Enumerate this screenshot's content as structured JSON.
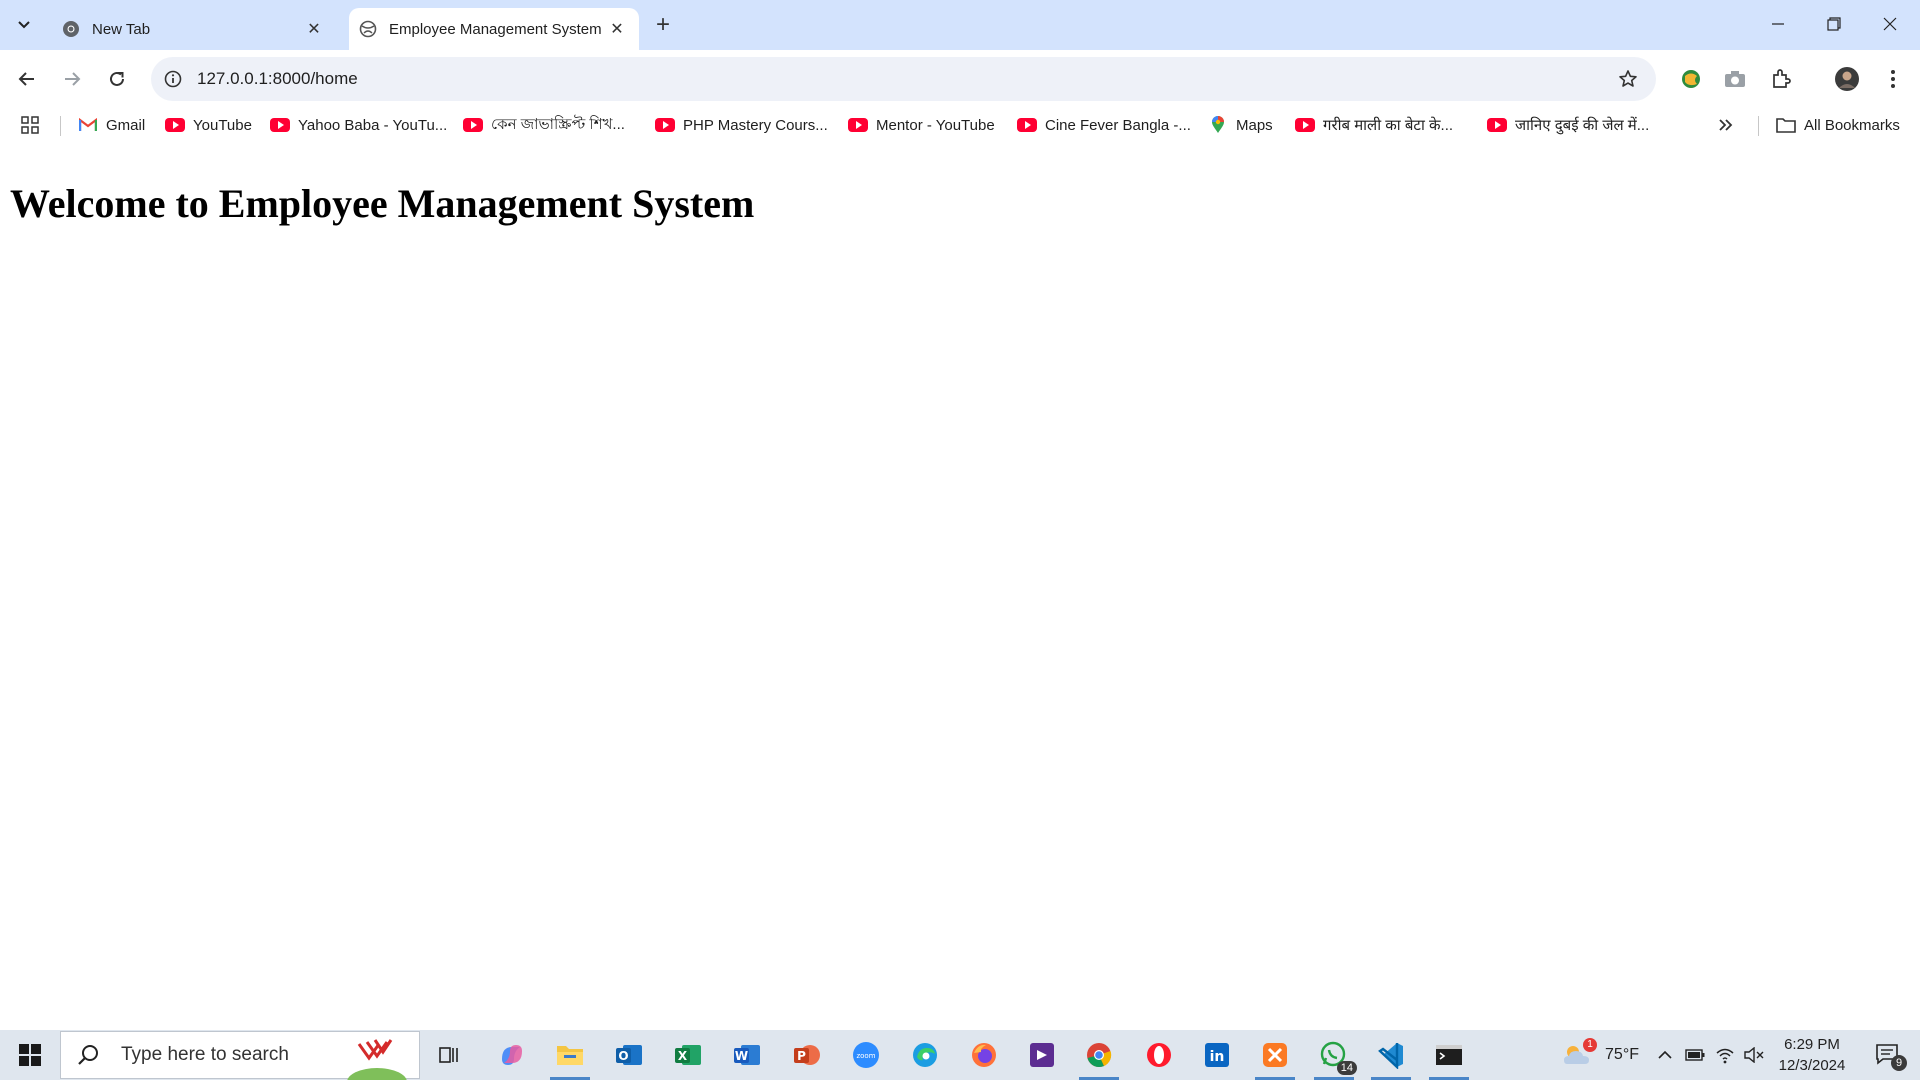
{
  "browser": {
    "tabs": [
      {
        "title": "New Tab",
        "active": false
      },
      {
        "title": "Employee Management System",
        "active": true
      }
    ],
    "address": {
      "url": "127.0.0.1:8000/home"
    },
    "bookmarks": [
      {
        "label": "Gmail",
        "icon": "gmail-icon"
      },
      {
        "label": "YouTube",
        "icon": "youtube-icon"
      },
      {
        "label": "Yahoo Baba - YouTu...",
        "icon": "youtube-icon"
      },
      {
        "label": "কেন জাভাস্ক্রিপ্ট শিখ...",
        "icon": "youtube-icon"
      },
      {
        "label": "PHP Mastery Cours...",
        "icon": "youtube-icon"
      },
      {
        "label": "Mentor - YouTube",
        "icon": "youtube-icon"
      },
      {
        "label": "Cine Fever Bangla -...",
        "icon": "youtube-icon"
      },
      {
        "label": "Maps",
        "icon": "maps-pin-icon"
      },
      {
        "label": "गरीब माली का बेटा के...",
        "icon": "youtube-icon"
      },
      {
        "label": "जानिए दुबई की जेल में...",
        "icon": "youtube-icon"
      }
    ],
    "all_bookmarks_label": "All Bookmarks",
    "colors": {
      "tabstrip": "#d3e3fd",
      "omnibox": "#eef1f8",
      "youtube_red": "#ff0033"
    }
  },
  "page": {
    "heading": "Welcome to Employee Management System"
  },
  "taskbar": {
    "search_placeholder": "Type here to search",
    "weather": {
      "temp": "75°F",
      "alert_count": "1"
    },
    "whatsapp_badge": "14",
    "clock": {
      "time": "6:29 PM",
      "date": "12/3/2024"
    },
    "notification_count": "9",
    "apps": [
      "task-view",
      "copilot",
      "file-explorer",
      "outlook",
      "excel",
      "word",
      "powerpoint",
      "zoom",
      "edge",
      "firefox",
      "visual-studio",
      "chrome",
      "opera",
      "linkedin",
      "xampp",
      "whatsapp",
      "vscode",
      "terminal"
    ]
  }
}
